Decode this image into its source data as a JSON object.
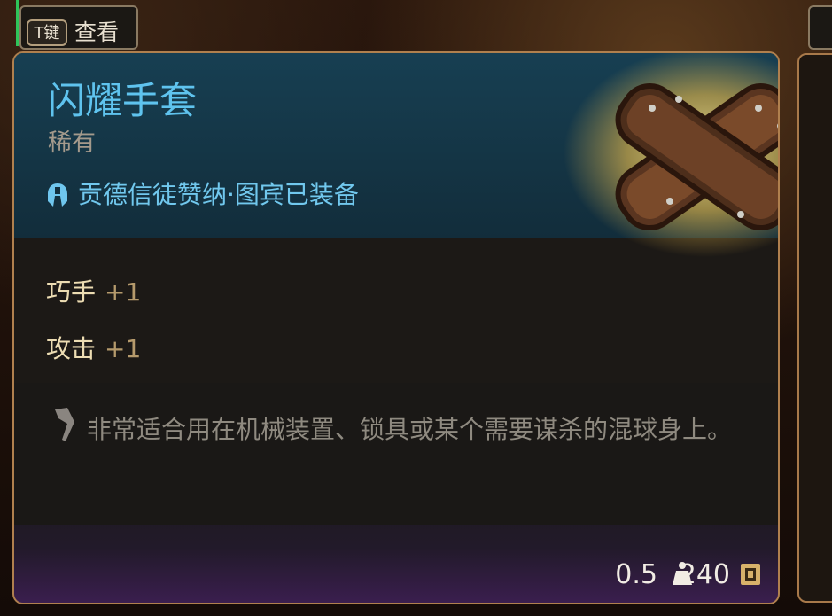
{
  "topbar": {
    "key": "T键",
    "label": "查看"
  },
  "item": {
    "name": "闪耀手套",
    "rarity": "稀有",
    "equipped_by": "贡德信徒赞纳·图宾已装备",
    "stats": [
      {
        "name": "巧手",
        "value": "+1"
      },
      {
        "name": "攻击",
        "value": "+1"
      }
    ],
    "description": "非常适合用在机械装置、锁具或某个需要谋杀的混球身上。",
    "weight": "0.5",
    "price": "240",
    "icons": {
      "equip": "helmet-icon",
      "description": "quill-icon",
      "weight": "weight-icon",
      "price": "coin-icon",
      "art": "gloves-illustration"
    },
    "colors": {
      "name": "#5fc3ee",
      "equip": "#71c8ee",
      "stat_label": "#ecdcb2",
      "stat_value": "#b59a6c",
      "border": "#b0804e"
    }
  }
}
